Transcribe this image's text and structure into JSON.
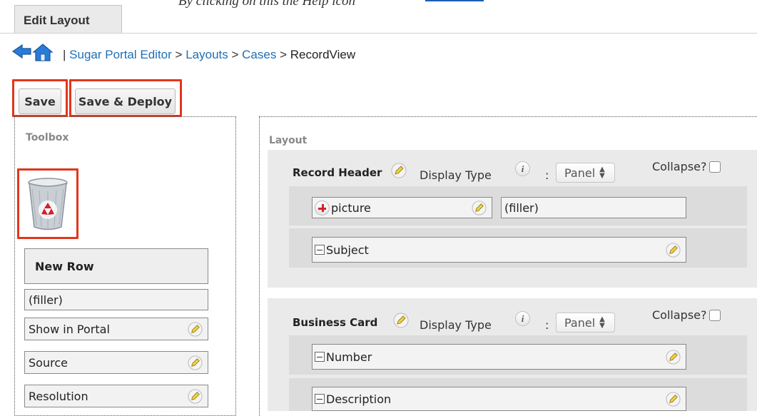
{
  "page_top": {
    "cutoff_text": "By clicking on this the Help icon"
  },
  "tab": {
    "label": "Edit Layout"
  },
  "breadcrumb": {
    "separator_pipe": "|",
    "items": [
      "Sugar Portal Editor",
      "Layouts",
      "Cases",
      "RecordView"
    ],
    "arrow": ">"
  },
  "toolbar": {
    "save_label": "Save",
    "save_deploy_label": "Save & Deploy"
  },
  "toolbox": {
    "title": "Toolbox",
    "trash_icon": "recycle-bin-icon",
    "new_row_label": "New Row",
    "filler_label": "(filler)",
    "fields": [
      "Show in Portal",
      "Source",
      "Resolution"
    ]
  },
  "layout": {
    "title": "Layout",
    "display_type_label": "Display Type",
    "colon": ":",
    "collapse_label": "Collapse?",
    "info_glyph": "i",
    "panels": [
      {
        "name": "Record Header",
        "display_type": "Panel",
        "rows": [
          {
            "fields": [
              {
                "label": "picture",
                "kind": "field-add"
              },
              {
                "label": "(filler)",
                "kind": "filler"
              }
            ]
          },
          {
            "fields": [
              {
                "label": "Subject",
                "kind": "field"
              }
            ]
          }
        ]
      },
      {
        "name": "Business Card",
        "display_type": "Panel",
        "rows": [
          {
            "fields": [
              {
                "label": "Number",
                "kind": "field"
              }
            ]
          },
          {
            "fields": [
              {
                "label": "Description",
                "kind": "field"
              }
            ]
          }
        ]
      }
    ]
  },
  "colors": {
    "highlight": "#e2361b",
    "link": "#1f6fb5",
    "accent_red": "#d4222a"
  }
}
